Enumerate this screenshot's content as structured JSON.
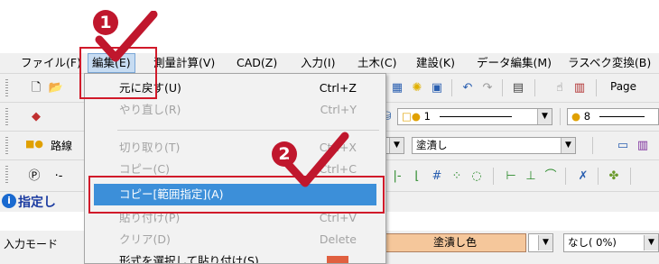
{
  "menubar": {
    "items": [
      "ファイル(F)",
      "編集(E)",
      "測量計算(V)",
      "CAD(Z)",
      "入力(I)",
      "土木(C)",
      "建設(K)",
      "データ編集(M)",
      "ラスベク変換(B)"
    ]
  },
  "toolbar1": {
    "page_label": "Page"
  },
  "toolbar2": {
    "layer_value": "1",
    "color_value": "8"
  },
  "toolbar3": {
    "road_label": "路線",
    "fill_combo": "塗潰し"
  },
  "info_label": "指定し",
  "status": {
    "input_mode_label": "入力モード",
    "fill_color_label": "塗潰し色",
    "opacity_value": "なし( 0%)"
  },
  "edit_menu": {
    "items": [
      {
        "label": "元に戻す(U)",
        "shortcut": "Ctrl+Z",
        "enabled": true
      },
      {
        "label": "やり直し(R)",
        "shortcut": "Ctrl+Y",
        "enabled": false
      },
      {
        "label": "切り取り(T)",
        "shortcut": "Ctrl+X",
        "enabled": false
      },
      {
        "label": "コピー(C)",
        "shortcut": "Ctrl+C",
        "enabled": false
      },
      {
        "label": "コピー[範囲指定](A)",
        "shortcut": "",
        "enabled": true,
        "highlighted": true
      },
      {
        "label": "貼り付け(P)",
        "shortcut": "Ctrl+V",
        "enabled": false
      },
      {
        "label": "クリア(D)",
        "shortcut": "Delete",
        "enabled": false
      },
      {
        "label": "形式を選択して貼り付け(S)",
        "shortcut": "",
        "enabled": true
      }
    ]
  },
  "callouts": {
    "step1": "1",
    "step2": "2"
  },
  "colors": {
    "callout_red": "#c0172d",
    "highlight_blue": "#3c8fd9",
    "fill_orange": "#f5c79b"
  }
}
